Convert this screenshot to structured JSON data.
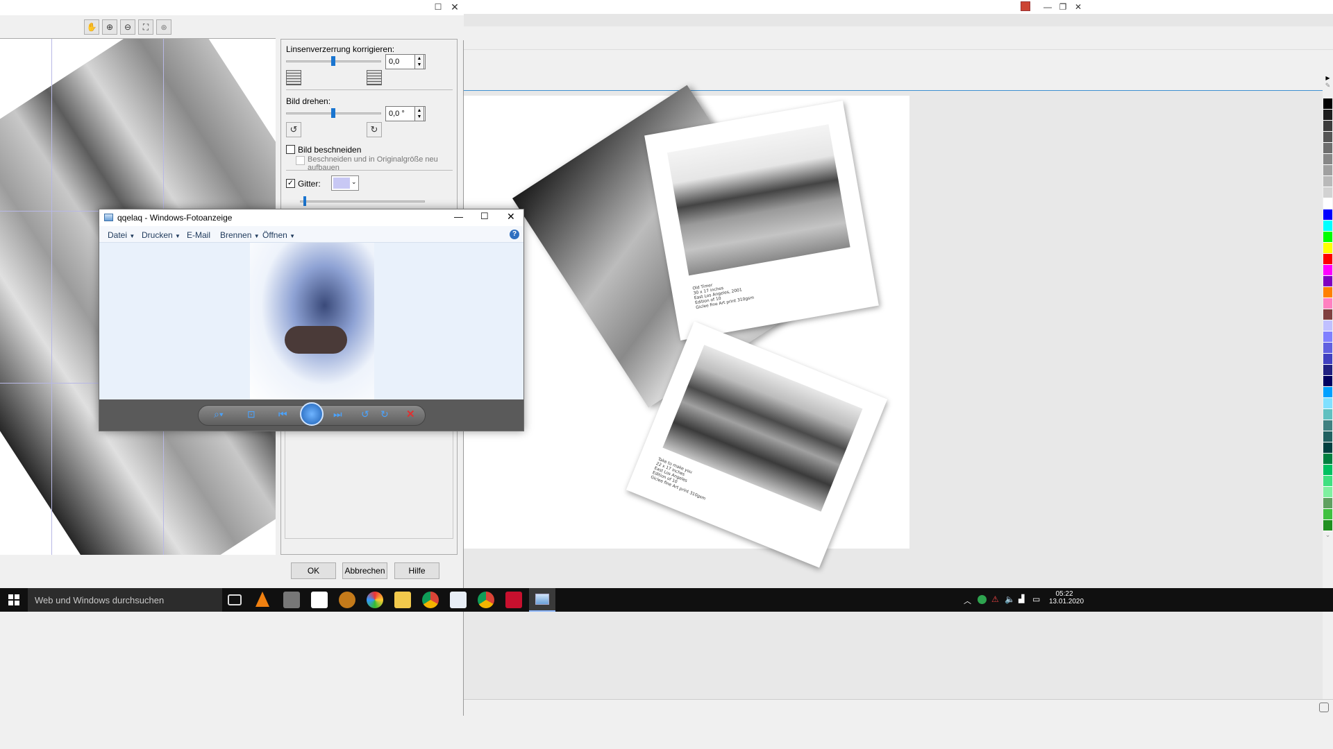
{
  "dialog": {
    "lens": {
      "label": "Linsenverzerrung korrigieren:",
      "value": "0,0"
    },
    "rotate": {
      "label": "Bild drehen:",
      "value": "0,0 °"
    },
    "crop": {
      "label": "Bild beschneiden",
      "checked": false
    },
    "crop_rebuild": {
      "label": "Beschneiden und in Originalgröße neu aufbauen",
      "checked": false
    },
    "grid": {
      "label": "Gitter:",
      "checked": true,
      "color": "#c8c8f4"
    },
    "buttons": {
      "ok": "OK",
      "cancel": "Abbrechen",
      "help": "Hilfe"
    },
    "toolbar_icons": [
      "hand-icon",
      "zoom-in-icon",
      "zoom-out-icon",
      "fit-icon",
      "zoom-100-icon"
    ]
  },
  "viewer": {
    "title": "qqelaq - Windows-Fotoanzeige",
    "menu": [
      "Datei",
      "Drucken",
      "E-Mail",
      "Brennen",
      "Öffnen"
    ],
    "controls": [
      "zoom-icon",
      "fit-window-icon",
      "previous-icon",
      "slideshow-icon",
      "next-icon",
      "rotate-left-icon",
      "rotate-right-icon",
      "delete-icon"
    ]
  },
  "canvas": {
    "photo_top": {
      "caption": [
        "Old Timer",
        "30 x 17 inches",
        "East Los Angeles, 2001",
        "Edition of 10",
        "Giclee fine Art print 310gsm"
      ]
    },
    "photo_bottom": {
      "caption": [
        "Take to make you",
        "22 x 17 inches",
        "East Los Angeles",
        "Edition of 10",
        "Giclee fine Art print 310gsm"
      ]
    }
  },
  "palette": [
    "#000000",
    "#1e1e1e",
    "#3c3c3c",
    "#555555",
    "#6e6e6e",
    "#878787",
    "#a0a0a0",
    "#b9b9b9",
    "#d2d2d2",
    "#ffffff",
    "#0000ff",
    "#00ffff",
    "#00ff00",
    "#ffff00",
    "#ff0000",
    "#ff00ff",
    "#8000c0",
    "#ff8000",
    "#ff80c0",
    "#804040",
    "#c0c0ff",
    "#8080ff",
    "#6060e0",
    "#4040c0",
    "#202080",
    "#000060",
    "#00a0ff",
    "#80e0ff",
    "#60c0c0",
    "#408080",
    "#206060",
    "#004040",
    "#008040",
    "#00c060",
    "#40e080",
    "#80f0a0",
    "#60a060",
    "#40c040",
    "#209020"
  ],
  "taskbar": {
    "search_placeholder": "Web und Windows durchsuchen",
    "time": "05:22",
    "date": "13.01.2020"
  }
}
